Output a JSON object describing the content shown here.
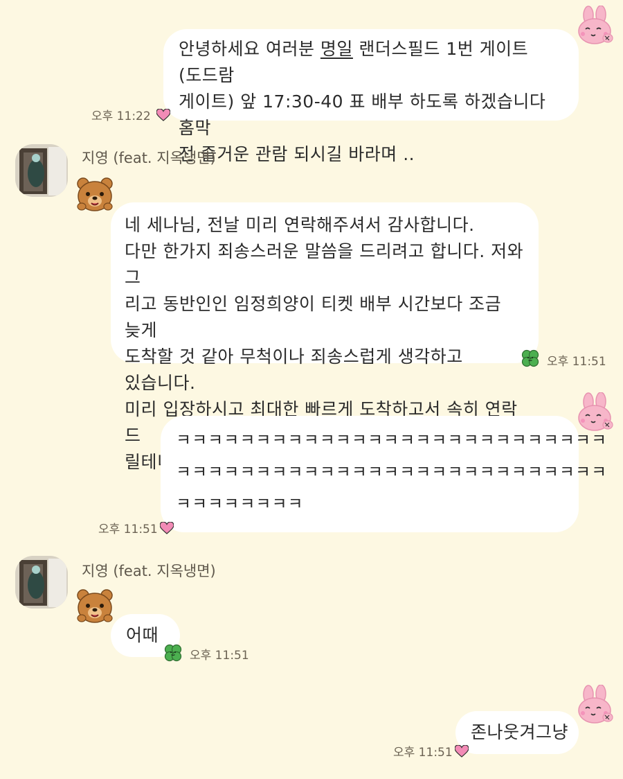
{
  "messages": {
    "m1": {
      "text_before": "안녕하세요 여러분 ",
      "text_mark": "명일",
      "text_after": " 랜더스필드 1번 게이트 (도드람\n게이트) 앞 17:30-40 표 배부 하도록 하겠습니다 홈막\n전 즐거운 관람 되시길 바라며 ..",
      "time": "오후 11:22"
    },
    "m2": {
      "sender": "지영 (feat. 지옥냉면)",
      "text": "네 세나님, 전날 미리 연락해주셔서 감사합니다.\n다만 한가지 죄송스러운 말씀을 드리려고 합니다. 저와 그\n리고 동반인인 임정희양이 티켓 배부 시간보다 조금 늦게\n도착할 것 같아 무척이나 죄송스럽게 생각하고 있습니다.\n미리 입장하시고 최대한 빠르게 도착하고서 속히 연락 드\n릴테니 너그럽게 양해 부탁드립니다.",
      "time": "오후 11:51"
    },
    "m3": {
      "text": "ㅋㅋㅋㅋㅋㅋㅋㅋㅋㅋㅋㅋㅋㅋㅋㅋㅋㅋㅋㅋㅋㅋㅋㅋㅋㅋㅋ\nㅋㅋㅋㅋㅋㅋㅋㅋㅋㅋㅋㅋㅋㅋㅋㅋㅋㅋㅋㅋㅋㅋㅋㅋㅋㅋㅋ\nㅋㅋㅋㅋㅋㅋㅋㅋ",
      "time": "오후 11:51"
    },
    "m4": {
      "sender": "지영 (feat. 지옥냉면)",
      "text": "어때",
      "time": "오후 11:51"
    },
    "m5": {
      "text": "존나웃겨그냥",
      "time": "오후 11:51"
    }
  },
  "icons": {
    "my_badge": "rabbit-icon",
    "their_badge": "bear-icon",
    "my_reaction": "heart-icon",
    "their_reaction": "clover-icon"
  },
  "colors": {
    "background": "#fdf8e2",
    "bubble": "#ffffff",
    "heart": "#f28bb6",
    "clover": "#4caf50",
    "rabbit": "#f7b6c9",
    "bear": "#c9823c"
  }
}
